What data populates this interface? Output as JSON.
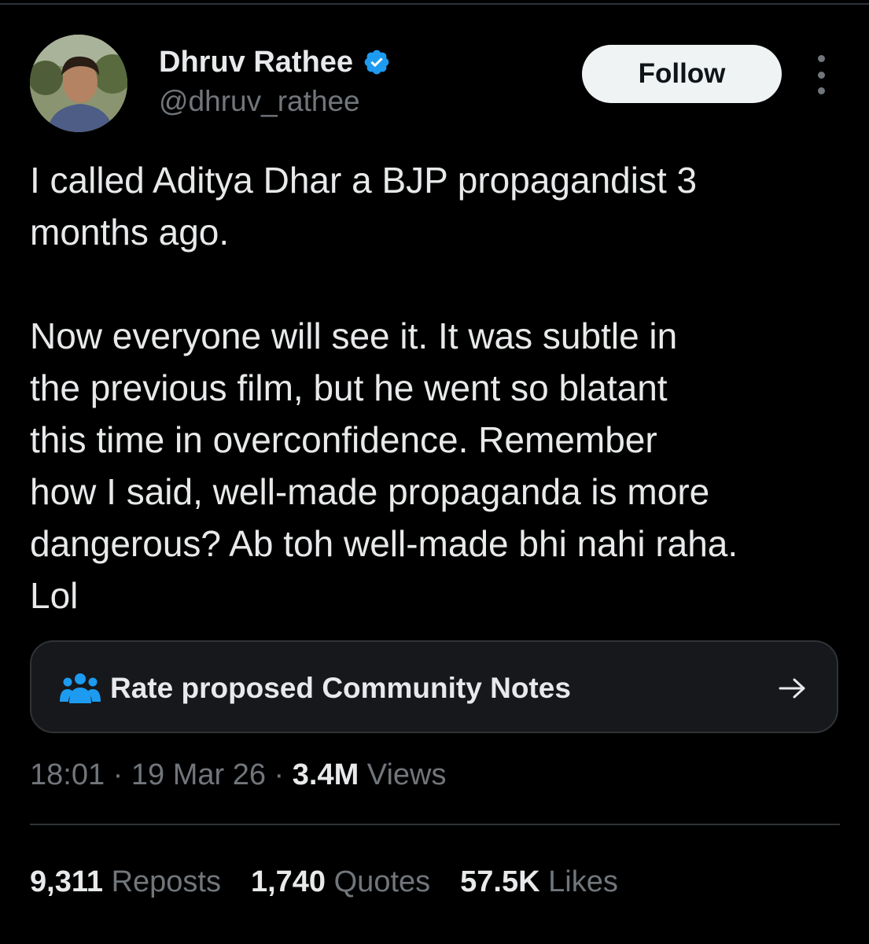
{
  "author": {
    "display_name": "Dhruv Rathee",
    "handle": "@dhruv_rathee",
    "verified_icon": "verified-badge-icon",
    "avatar": "profile-photo"
  },
  "actions": {
    "follow_label": "Follow",
    "more_icon": "more-vertical-icon"
  },
  "tweet": {
    "text": "I called Aditya Dhar a BJP propagandist 3\nmonths ago.\n\nNow everyone will see it. It was subtle in\nthe previous film, but he went so blatant\nthis time in overconfidence. Remember\nhow I said, well-made propaganda is more\ndangerous? Ab toh well-made bhi nahi raha.\nLol"
  },
  "community_notes": {
    "label": "Rate proposed Community Notes",
    "icon": "people-group-icon",
    "arrow_icon": "arrow-right-icon"
  },
  "meta": {
    "time": "18:01",
    "separator": "·",
    "date": "19 Mar 26",
    "views_count": "3.4M",
    "views_label": "Views"
  },
  "stats": [
    {
      "count": "9,311",
      "label": "Reposts"
    },
    {
      "count": "1,740",
      "label": "Quotes"
    },
    {
      "count": "57.5K",
      "label": "Likes"
    }
  ],
  "colors": {
    "background": "#000000",
    "text_primary": "#e7e9ea",
    "text_secondary": "#71767b",
    "verified": "#1d9bf0",
    "border": "#2f3336"
  }
}
